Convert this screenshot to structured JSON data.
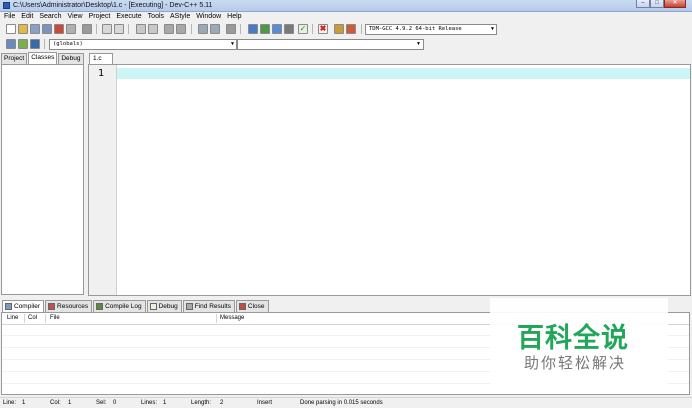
{
  "window": {
    "title": "C:\\Users\\Administrator\\Desktop\\1.c - [Executing] - Dev-C++ 5.11",
    "min_label": "–",
    "max_label": "□",
    "close_label": "✕"
  },
  "menu": [
    "File",
    "Edit",
    "Search",
    "View",
    "Project",
    "Execute",
    "Tools",
    "AStyle",
    "Window",
    "Help"
  ],
  "toolbar": {
    "compiler_select": "TDM-GCC 4.9.2 64-bit Release",
    "scope_select": "(globals)",
    "function_select": ""
  },
  "left_tabs": [
    "Project",
    "Classes",
    "Debug"
  ],
  "left_active_tab": "Classes",
  "editor": {
    "tab_label": "1.c",
    "line_numbers": [
      "1"
    ],
    "current_line_color": "#ccf5f5"
  },
  "bottom_tabs": [
    {
      "label": "Compiler",
      "icon": "compiler-icon"
    },
    {
      "label": "Resources",
      "icon": "resources-icon"
    },
    {
      "label": "Compile Log",
      "icon": "compile-log-icon"
    },
    {
      "label": "Debug",
      "icon": "debug-icon"
    },
    {
      "label": "Find Results",
      "icon": "find-results-icon"
    },
    {
      "label": "Close",
      "icon": "close-icon"
    }
  ],
  "messages_header": [
    "Line",
    "Col",
    "File",
    "Message"
  ],
  "status": {
    "line_label": "Line:",
    "line_value": "1",
    "col_label": "Col:",
    "col_value": "1",
    "sel_label": "Sel:",
    "sel_value": "0",
    "lines_label": "Lines:",
    "lines_value": "1",
    "length_label": "Length:",
    "length_value": "2",
    "mode": "Insert",
    "message": "Done parsing in 0.015 seconds"
  },
  "watermark": {
    "title": "百科全说",
    "subtitle": "助你轻松解决",
    "color": "#22a65a"
  }
}
